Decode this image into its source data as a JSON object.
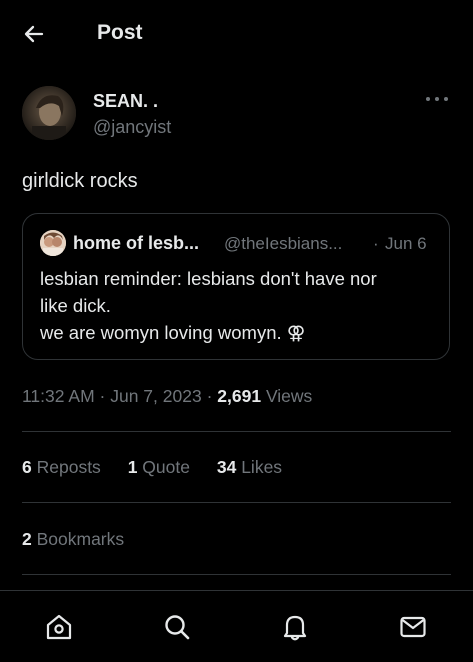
{
  "header": {
    "title": "Post"
  },
  "author": {
    "name": "SEAN. .",
    "handle": "@jancyist"
  },
  "post": {
    "text": "girldick rocks"
  },
  "quote": {
    "name": "home of lesb...",
    "handle": "@theIesbians...",
    "separator": "·",
    "date": "Jun 6",
    "lines": [
      "lesbian reminder: lesbians don't have nor",
      "like dick.",
      "we are womyn loving womyn. ⚢"
    ]
  },
  "meta": {
    "time": "11:32 AM",
    "sep": "·",
    "date": "Jun 7, 2023",
    "views_count": "2,691",
    "views_label": "Views"
  },
  "stats": {
    "reposts_count": "6",
    "reposts_label": "Reposts",
    "quotes_count": "1",
    "quotes_label": "Quote",
    "likes_count": "34",
    "likes_label": "Likes",
    "bookmarks_count": "2",
    "bookmarks_label": "Bookmarks"
  },
  "tabbar": {
    "icons": [
      "home-icon",
      "search-icon",
      "notifications-icon",
      "messages-icon"
    ]
  },
  "colors": {
    "background": "#000000",
    "text": "#e7e9ea",
    "muted": "#71767b",
    "border": "#2f3336"
  }
}
